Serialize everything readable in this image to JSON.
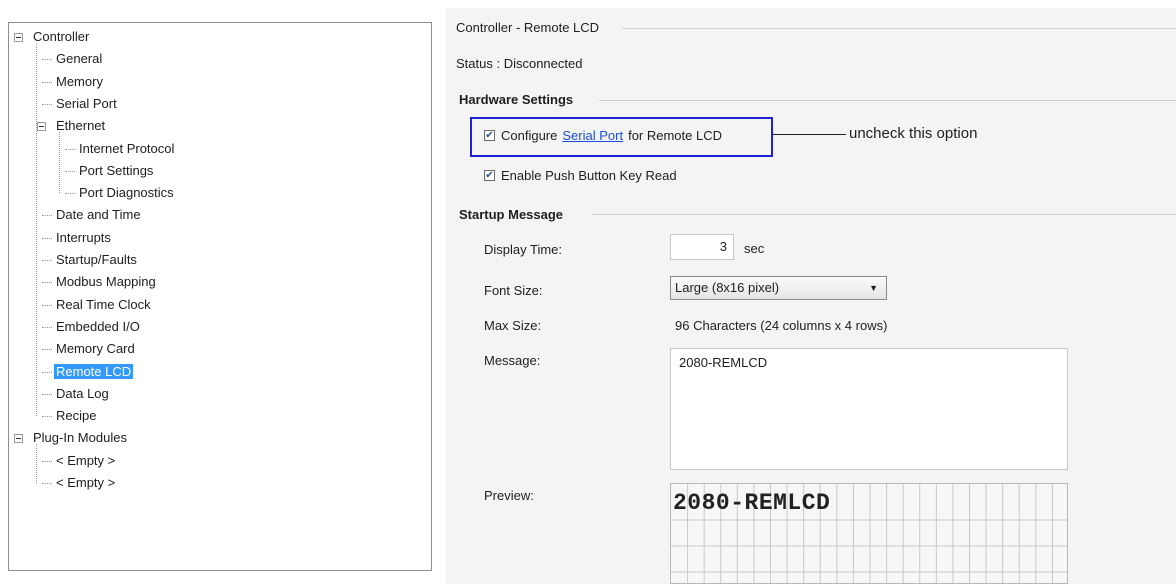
{
  "tree": {
    "items": [
      {
        "label": "Controller",
        "level": 0,
        "expandable": true
      },
      {
        "label": "General",
        "level": 1
      },
      {
        "label": "Memory",
        "level": 1
      },
      {
        "label": "Serial Port",
        "level": 1
      },
      {
        "label": "Ethernet",
        "level": 1,
        "expandable": true
      },
      {
        "label": "Internet Protocol",
        "level": 2
      },
      {
        "label": "Port Settings",
        "level": 2
      },
      {
        "label": "Port Diagnostics",
        "level": 2
      },
      {
        "label": "Date and Time",
        "level": 1
      },
      {
        "label": "Interrupts",
        "level": 1
      },
      {
        "label": "Startup/Faults",
        "level": 1
      },
      {
        "label": "Modbus Mapping",
        "level": 1
      },
      {
        "label": "Real Time Clock",
        "level": 1
      },
      {
        "label": "Embedded I/O",
        "level": 1
      },
      {
        "label": "Memory Card",
        "level": 1
      },
      {
        "label": "Remote LCD",
        "level": 1,
        "selected": true
      },
      {
        "label": "Data Log",
        "level": 1
      },
      {
        "label": "Recipe",
        "level": 1
      },
      {
        "label": "Plug-In Modules",
        "level": 0,
        "expandable": true
      },
      {
        "label": "< Empty >",
        "level": 1
      },
      {
        "label": "< Empty >",
        "level": 1
      }
    ]
  },
  "panel": {
    "title": "Controller - Remote LCD",
    "status": "Status : Disconnected",
    "hardware": {
      "heading": "Hardware Settings",
      "configure_prefix": "Configure",
      "configure_link": "Serial Port",
      "configure_suffix": "for Remote LCD",
      "configure_checked": true,
      "push_button_label": "Enable Push Button Key Read",
      "push_button_checked": true
    },
    "callout": "uncheck this option",
    "startup": {
      "heading": "Startup Message",
      "display_time_label": "Display Time:",
      "display_time_value": "3",
      "display_time_unit": "sec",
      "font_size_label": "Font Size:",
      "font_size_value": "Large (8x16 pixel)",
      "max_size_label": "Max Size:",
      "max_size_value": "96 Characters (24 columns x 4 rows)",
      "message_label": "Message:",
      "message_value": "2080-REMLCD",
      "preview_label": "Preview:",
      "preview_text": "2080-REMLCD"
    }
  },
  "colors": {
    "selection": "#3399ff",
    "callout_border": "#1f1fd6",
    "link": "#1a4fd6"
  }
}
